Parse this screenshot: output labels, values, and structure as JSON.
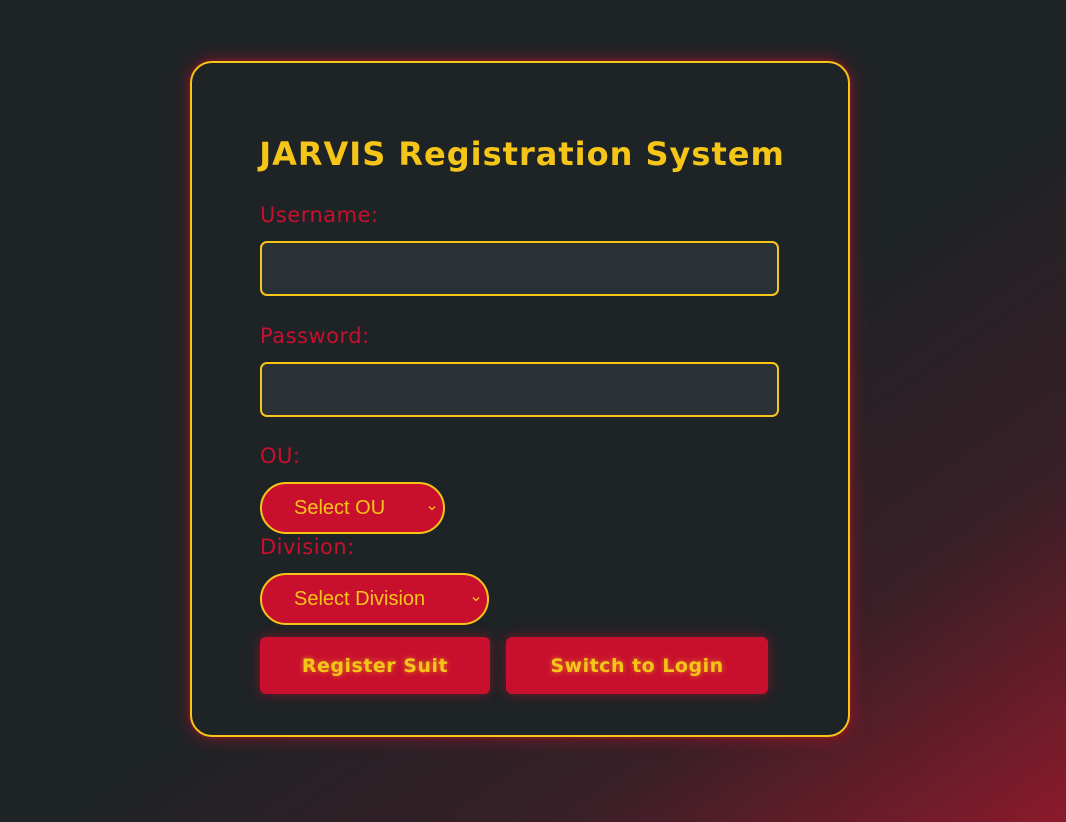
{
  "form": {
    "title": "JARVIS Registration System",
    "username": {
      "label": "Username:",
      "value": "",
      "placeholder": ""
    },
    "password": {
      "label": "Password:",
      "value": "",
      "placeholder": ""
    },
    "ou": {
      "label": "OU:",
      "selected": "Select OU"
    },
    "division": {
      "label": "Division:",
      "selected": "Select Division"
    },
    "buttons": {
      "register": "Register Suit",
      "switch_login": "Switch to Login"
    }
  },
  "colors": {
    "accent_yellow": "#f5c518",
    "accent_red": "#c8102e",
    "background": "#1e2326",
    "input_bg": "#2a3134"
  },
  "icons": {
    "select_chevron": "chevron-down-icon"
  }
}
